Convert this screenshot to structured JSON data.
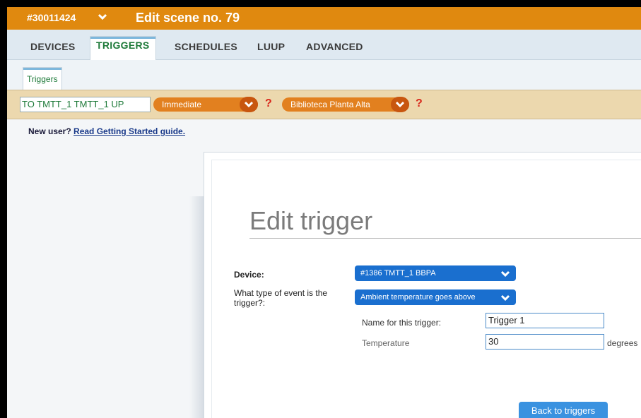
{
  "header": {
    "device_id": "#30011424",
    "title": "Edit scene no. 79"
  },
  "tabs": [
    "DEVICES",
    "TRIGGERS",
    "SCHEDULES",
    "LUUP",
    "ADVANCED"
  ],
  "subtab": "Triggers",
  "scene": {
    "name": "TO TMTT_1 TMTT_1 UP",
    "mode": "Immediate",
    "room": "Biblioteca Planta Alta",
    "help": "?"
  },
  "new_user": {
    "prefix": "New user?",
    "link": "Read Getting Started guide."
  },
  "edit_trigger": {
    "heading": "Edit trigger",
    "device_label": "Device:",
    "device_value": "#1386 TMTT_1 BBPA",
    "event_label": "What type of event is the trigger?:",
    "event_value": "Ambient temperature goes above",
    "name_label": "Name for this trigger:",
    "name_value": "Trigger 1",
    "temp_label": "Temperature",
    "temp_value": "30",
    "temp_unit": "degrees",
    "back_button": "Back to triggers"
  },
  "colors": {
    "header": "#e0890f",
    "accent_green": "#1e7a39",
    "select_blue": "#1a6fcf",
    "pill_orange": "#e2801f"
  }
}
